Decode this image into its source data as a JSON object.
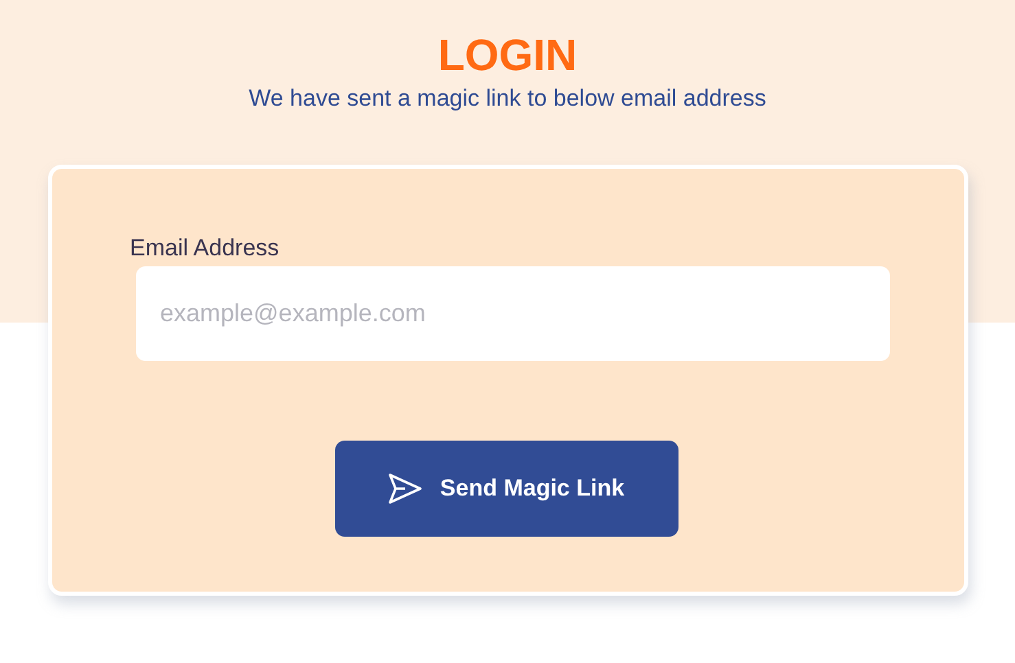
{
  "header": {
    "title": "LOGIN",
    "subtitle": "We have sent a magic link to below email address"
  },
  "form": {
    "email_label": "Email Address",
    "email_placeholder": "example@example.com",
    "submit_button": "Send Magic Link"
  }
}
